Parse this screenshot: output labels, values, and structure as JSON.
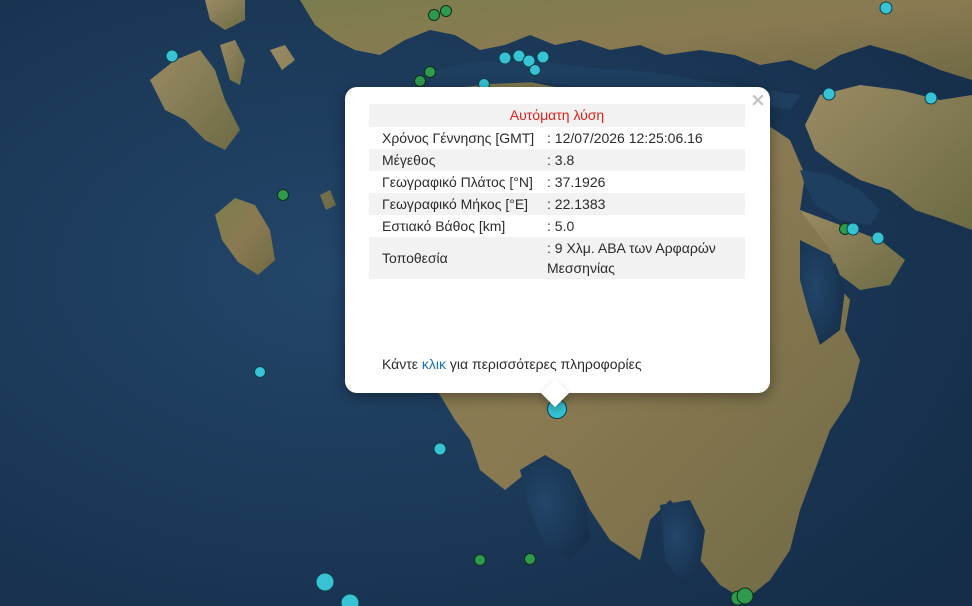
{
  "popup": {
    "title": "Αυτόματη λύση",
    "close_label": "×",
    "rows": [
      {
        "label": "Χρόνος Γέννησης [GMT]",
        "value": ": 12/07/2026 12:25:06.16"
      },
      {
        "label": "Μέγεθος",
        "value": ": 3.8"
      },
      {
        "label": "Γεωγραφικό Πλάτος [°N]",
        "value": ": 37.1926"
      },
      {
        "label": "Γεωγραφικό Μήκος [°E]",
        "value": ": 22.1383"
      },
      {
        "label": "Εστιακό Βάθος [km]",
        "value": ": 5.0"
      },
      {
        "label": "Τοποθεσία",
        "value": ": 9 Χλμ. ΑΒΑ των Αρφαρών Μεσσηνίας"
      }
    ],
    "footer_prefix": "Κάντε ",
    "footer_link": "κλικ",
    "footer_suffix": " για περισσότερες πληροφορίες"
  },
  "colors": {
    "marker_recent": "#37c3d4",
    "marker_older": "#2f9a4e",
    "title_text": "#e0201c",
    "link": "#1a6fb0"
  }
}
